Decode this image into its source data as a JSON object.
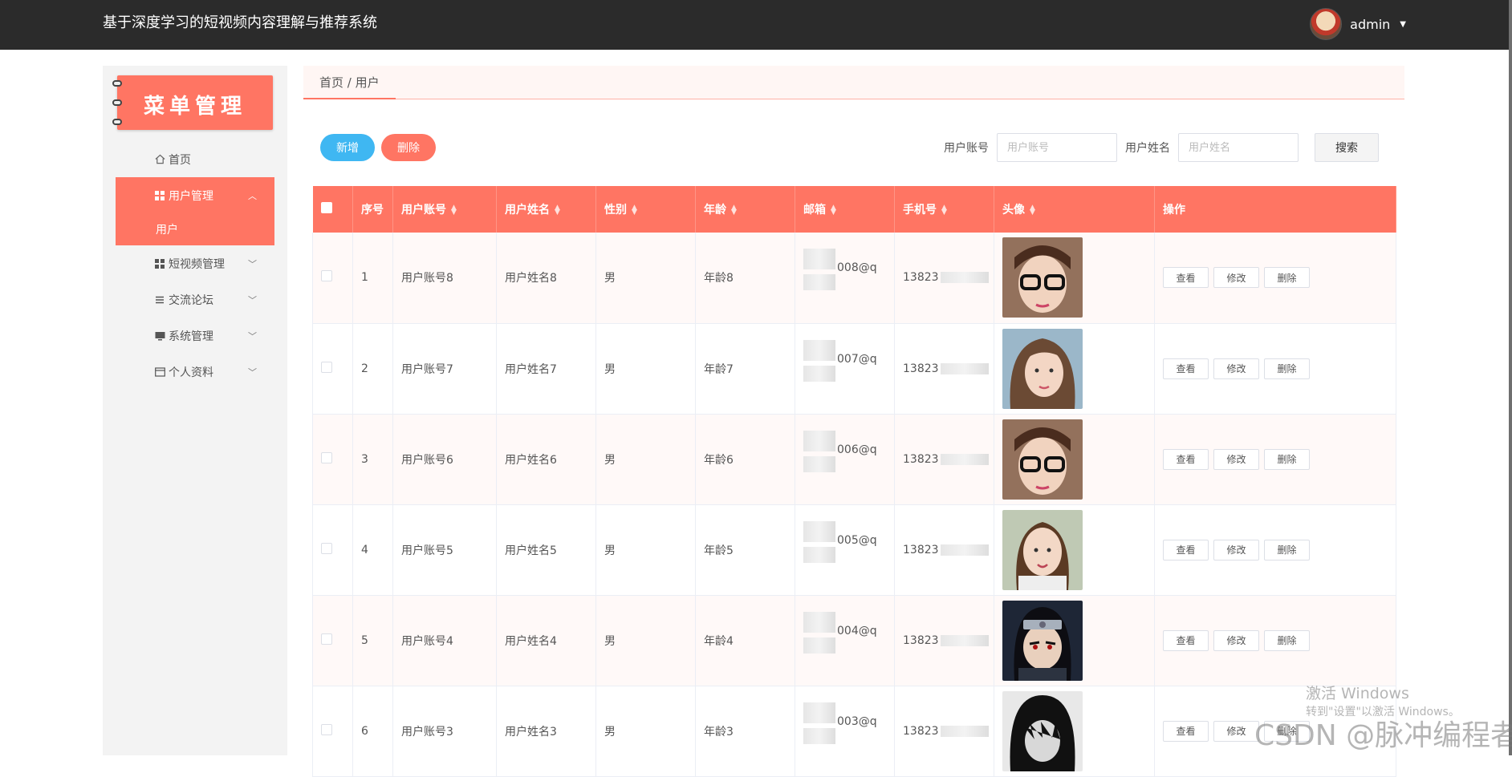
{
  "app": {
    "title": "基于深度学习的短视频内容理解与推荐系统",
    "user": "admin"
  },
  "sidebar": {
    "banner": "菜单管理",
    "items": [
      {
        "label": "首页",
        "icon": "home-icon"
      },
      {
        "label": "用户管理",
        "icon": "grid-icon",
        "expanded": true,
        "children": [
          {
            "label": "用户"
          }
        ]
      },
      {
        "label": "短视频管理",
        "icon": "grid-icon"
      },
      {
        "label": "交流论坛",
        "icon": "list-icon"
      },
      {
        "label": "系统管理",
        "icon": "monitor-icon"
      },
      {
        "label": "个人资料",
        "icon": "card-icon"
      }
    ]
  },
  "breadcrumb": "首页 / 用户",
  "toolbar": {
    "add_label": "新增",
    "delete_label": "删除"
  },
  "search": {
    "account_label": "用户账号",
    "account_placeholder": "用户账号",
    "name_label": "用户姓名",
    "name_placeholder": "用户姓名",
    "button_label": "搜索"
  },
  "table": {
    "headers": [
      "",
      "序号",
      "用户账号",
      "用户姓名",
      "性别",
      "年龄",
      "邮箱",
      "手机号",
      "头像",
      "操作"
    ],
    "rows": [
      {
        "index": "1",
        "account": "用户账号8",
        "name": "用户姓名8",
        "gender": "男",
        "age": "年龄8",
        "email": "008@q",
        "phone": "13823",
        "photo": "photo-girl-glasses"
      },
      {
        "index": "2",
        "account": "用户账号7",
        "name": "用户姓名7",
        "gender": "男",
        "age": "年龄7",
        "email": "007@q",
        "phone": "13823",
        "photo": "photo-girl-hair"
      },
      {
        "index": "3",
        "account": "用户账号6",
        "name": "用户姓名6",
        "gender": "男",
        "age": "年龄6",
        "email": "006@q",
        "phone": "13823",
        "photo": "photo-girl-glasses"
      },
      {
        "index": "4",
        "account": "用户账号5",
        "name": "用户姓名5",
        "gender": "男",
        "age": "年龄5",
        "email": "005@q",
        "phone": "13823",
        "photo": "photo-girl-braid"
      },
      {
        "index": "5",
        "account": "用户账号4",
        "name": "用户姓名4",
        "gender": "男",
        "age": "年龄4",
        "email": "004@q",
        "phone": "13823",
        "photo": "photo-anime-ninja"
      },
      {
        "index": "6",
        "account": "用户账号3",
        "name": "用户姓名3",
        "gender": "男",
        "age": "年龄3",
        "email": "003@q",
        "phone": "13823",
        "photo": "photo-anime-dark"
      }
    ],
    "actions": [
      "查看",
      "修改",
      "删除"
    ]
  },
  "watermark": {
    "line1": "激活 Windows",
    "line2": "转到\"设置\"以激活 Windows。",
    "line3": "CSDN @脉冲编程者"
  },
  "colors": {
    "accent": "#ff7563",
    "blue": "#3fb7f2",
    "topbar": "#2b2b2b"
  }
}
